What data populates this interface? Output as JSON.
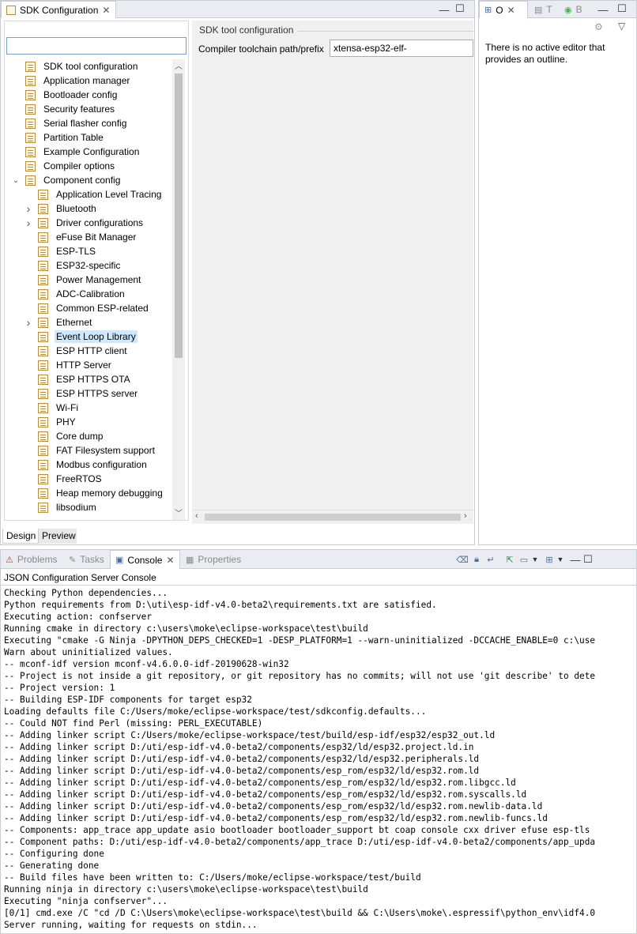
{
  "editor": {
    "tab_title": "SDK Configuration",
    "search_placeholder": "",
    "tree": [
      {
        "label": "SDK tool configuration",
        "level": 0,
        "expander": ""
      },
      {
        "label": "Application manager",
        "level": 0,
        "expander": ""
      },
      {
        "label": "Bootloader config",
        "level": 0,
        "expander": ""
      },
      {
        "label": "Security features",
        "level": 0,
        "expander": ""
      },
      {
        "label": "Serial flasher config",
        "level": 0,
        "expander": ""
      },
      {
        "label": "Partition Table",
        "level": 0,
        "expander": ""
      },
      {
        "label": "Example Configuration",
        "level": 0,
        "expander": ""
      },
      {
        "label": "Compiler options",
        "level": 0,
        "expander": ""
      },
      {
        "label": "Component config",
        "level": 0,
        "expander": "expanded"
      },
      {
        "label": "Application Level Tracing",
        "level": 1,
        "expander": ""
      },
      {
        "label": "Bluetooth",
        "level": 1,
        "expander": "collapsed"
      },
      {
        "label": "Driver configurations",
        "level": 1,
        "expander": "collapsed"
      },
      {
        "label": "eFuse Bit Manager",
        "level": 1,
        "expander": ""
      },
      {
        "label": "ESP-TLS",
        "level": 1,
        "expander": ""
      },
      {
        "label": "ESP32-specific",
        "level": 1,
        "expander": ""
      },
      {
        "label": "Power Management",
        "level": 1,
        "expander": ""
      },
      {
        "label": "ADC-Calibration",
        "level": 1,
        "expander": ""
      },
      {
        "label": "Common ESP-related",
        "level": 1,
        "expander": ""
      },
      {
        "label": "Ethernet",
        "level": 1,
        "expander": "collapsed"
      },
      {
        "label": "Event Loop Library",
        "level": 1,
        "expander": "",
        "selected": true
      },
      {
        "label": "ESP HTTP client",
        "level": 1,
        "expander": ""
      },
      {
        "label": "HTTP Server",
        "level": 1,
        "expander": ""
      },
      {
        "label": "ESP HTTPS OTA",
        "level": 1,
        "expander": ""
      },
      {
        "label": "ESP HTTPS server",
        "level": 1,
        "expander": ""
      },
      {
        "label": "Wi-Fi",
        "level": 1,
        "expander": ""
      },
      {
        "label": "PHY",
        "level": 1,
        "expander": ""
      },
      {
        "label": "Core dump",
        "level": 1,
        "expander": ""
      },
      {
        "label": "FAT Filesystem support",
        "level": 1,
        "expander": ""
      },
      {
        "label": "Modbus configuration",
        "level": 1,
        "expander": ""
      },
      {
        "label": "FreeRTOS",
        "level": 1,
        "expander": ""
      },
      {
        "label": "Heap memory debugging",
        "level": 1,
        "expander": ""
      },
      {
        "label": "libsodium",
        "level": 1,
        "expander": ""
      }
    ],
    "group_title": "SDK tool configuration",
    "field_label": "Compiler toolchain path/prefix",
    "field_value": "xtensa-esp32-elf-",
    "bottom_tabs": [
      "Design",
      "Preview"
    ]
  },
  "outline": {
    "tabs": [
      "O",
      "T",
      "B"
    ],
    "message": "There is no active editor that provides an outline."
  },
  "bottom_panel": {
    "tabs": [
      "Problems",
      "Tasks",
      "Console",
      "Properties"
    ],
    "active_tab": "Console",
    "console_title": "JSON Configuration Server Console",
    "lines": [
      "Checking Python dependencies...",
      "Python requirements from D:\\uti\\esp-idf-v4.0-beta2\\requirements.txt are satisfied.",
      "Executing action: confserver",
      "Running cmake in directory c:\\users\\moke\\eclipse-workspace\\test\\build",
      "Executing \"cmake -G Ninja -DPYTHON_DEPS_CHECKED=1 -DESP_PLATFORM=1 --warn-uninitialized -DCCACHE_ENABLE=0 c:\\use",
      "Warn about uninitialized values.",
      "-- mconf-idf version mconf-v4.6.0.0-idf-20190628-win32",
      "-- Project is not inside a git repository, or git repository has no commits; will not use 'git describe' to dete",
      "-- Project version: 1",
      "-- Building ESP-IDF components for target esp32",
      "Loading defaults file C:/Users/moke/eclipse-workspace/test/sdkconfig.defaults...",
      "-- Could NOT find Perl (missing: PERL_EXECUTABLE)",
      "-- Adding linker script C:/Users/moke/eclipse-workspace/test/build/esp-idf/esp32/esp32_out.ld",
      "-- Adding linker script D:/uti/esp-idf-v4.0-beta2/components/esp32/ld/esp32.project.ld.in",
      "-- Adding linker script D:/uti/esp-idf-v4.0-beta2/components/esp32/ld/esp32.peripherals.ld",
      "-- Adding linker script D:/uti/esp-idf-v4.0-beta2/components/esp_rom/esp32/ld/esp32.rom.ld",
      "-- Adding linker script D:/uti/esp-idf-v4.0-beta2/components/esp_rom/esp32/ld/esp32.rom.libgcc.ld",
      "-- Adding linker script D:/uti/esp-idf-v4.0-beta2/components/esp_rom/esp32/ld/esp32.rom.syscalls.ld",
      "-- Adding linker script D:/uti/esp-idf-v4.0-beta2/components/esp_rom/esp32/ld/esp32.rom.newlib-data.ld",
      "-- Adding linker script D:/uti/esp-idf-v4.0-beta2/components/esp_rom/esp32/ld/esp32.rom.newlib-funcs.ld",
      "-- Components: app_trace app_update asio bootloader bootloader_support bt coap console cxx driver efuse esp-tls",
      "-- Component paths: D:/uti/esp-idf-v4.0-beta2/components/app_trace D:/uti/esp-idf-v4.0-beta2/components/app_upda",
      "-- Configuring done",
      "-- Generating done",
      "-- Build files have been written to: C:/Users/moke/eclipse-workspace/test/build",
      "Running ninja in directory c:\\users\\moke\\eclipse-workspace\\test\\build",
      "Executing \"ninja confserver\"...",
      "[0/1] cmd.exe /C \"cd /D C:\\Users\\moke\\eclipse-workspace\\test\\build && C:\\Users\\moke\\.espressif\\python_env\\idf4.0",
      "Server running, waiting for requests on stdin..."
    ]
  }
}
